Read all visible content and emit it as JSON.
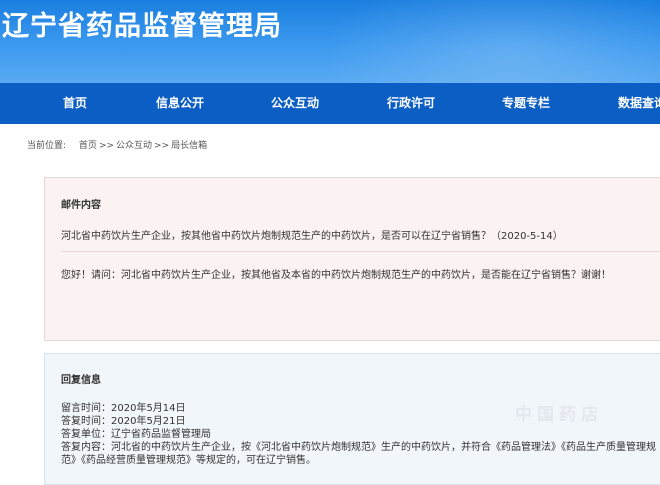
{
  "site": {
    "title": "辽宁省药品监督管理局"
  },
  "nav": {
    "items": [
      "首页",
      "信息公开",
      "公众互动",
      "行政许可",
      "专题专栏",
      "数据查询"
    ]
  },
  "breadcrumb": {
    "label": "当前位置:",
    "home": "首页",
    "sep1": ">>",
    "level1": "公众互动",
    "sep2": ">>",
    "level2": "局长信箱"
  },
  "mail": {
    "heading": "邮件内容",
    "subject": "河北省中药饮片生产企业，按其他省中药饮片炮制规范生产的中药饮片，是否可以在辽宁省销售？（2020-5-14）",
    "body": "您好！请问：河北省中药饮片生产企业，按其他省及本省的中药饮片炮制规范生产的中药饮片，是否能在辽宁省销售？谢谢！"
  },
  "reply": {
    "heading": "回复信息",
    "message_time": "留言时间：2020年5月14日",
    "answer_time": "答复时间：2020年5月21日",
    "answer_unit": "答复单位：辽宁省药品监督管理局",
    "answer_content_1": "答复内容：河北省的中药饮片生产企业，按《河北省中药饮片炮制规范》生产的中药饮片，并符合《药品管理法》《药品生产质量管理规",
    "answer_content_2": "范》《药品经营质量管理规范》等规定的，可在辽宁销售。"
  },
  "watermark": {
    "text": "中国药店"
  }
}
